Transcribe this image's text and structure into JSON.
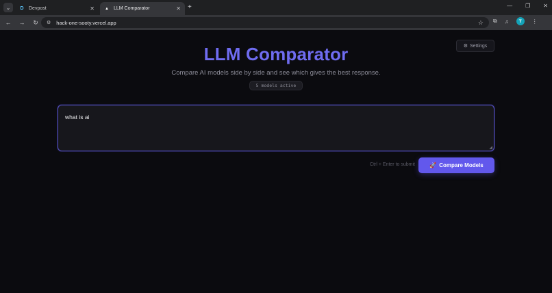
{
  "browser": {
    "tabs": [
      {
        "label": "Devpost",
        "favicon": "devpost-logo",
        "active": false
      },
      {
        "label": "LLM Comparator",
        "favicon": "triangle-logo",
        "active": true
      }
    ],
    "url": "hack-one-sooty.vercel.app",
    "profile_initial": "T"
  },
  "page": {
    "settings_label": "Settings",
    "title": "LLM Comparator",
    "subtitle": "Compare AI models side by side and see which gives the best response.",
    "badge": "5 models active",
    "prompt_value": "what is ai",
    "hint": "Ctrl + Enter to submit",
    "compare_label": "Compare Models"
  },
  "colors": {
    "accent": "#6258ec",
    "title": "#6f6cf0",
    "background": "#0b0b0f",
    "focus_border": "#5551c7"
  }
}
